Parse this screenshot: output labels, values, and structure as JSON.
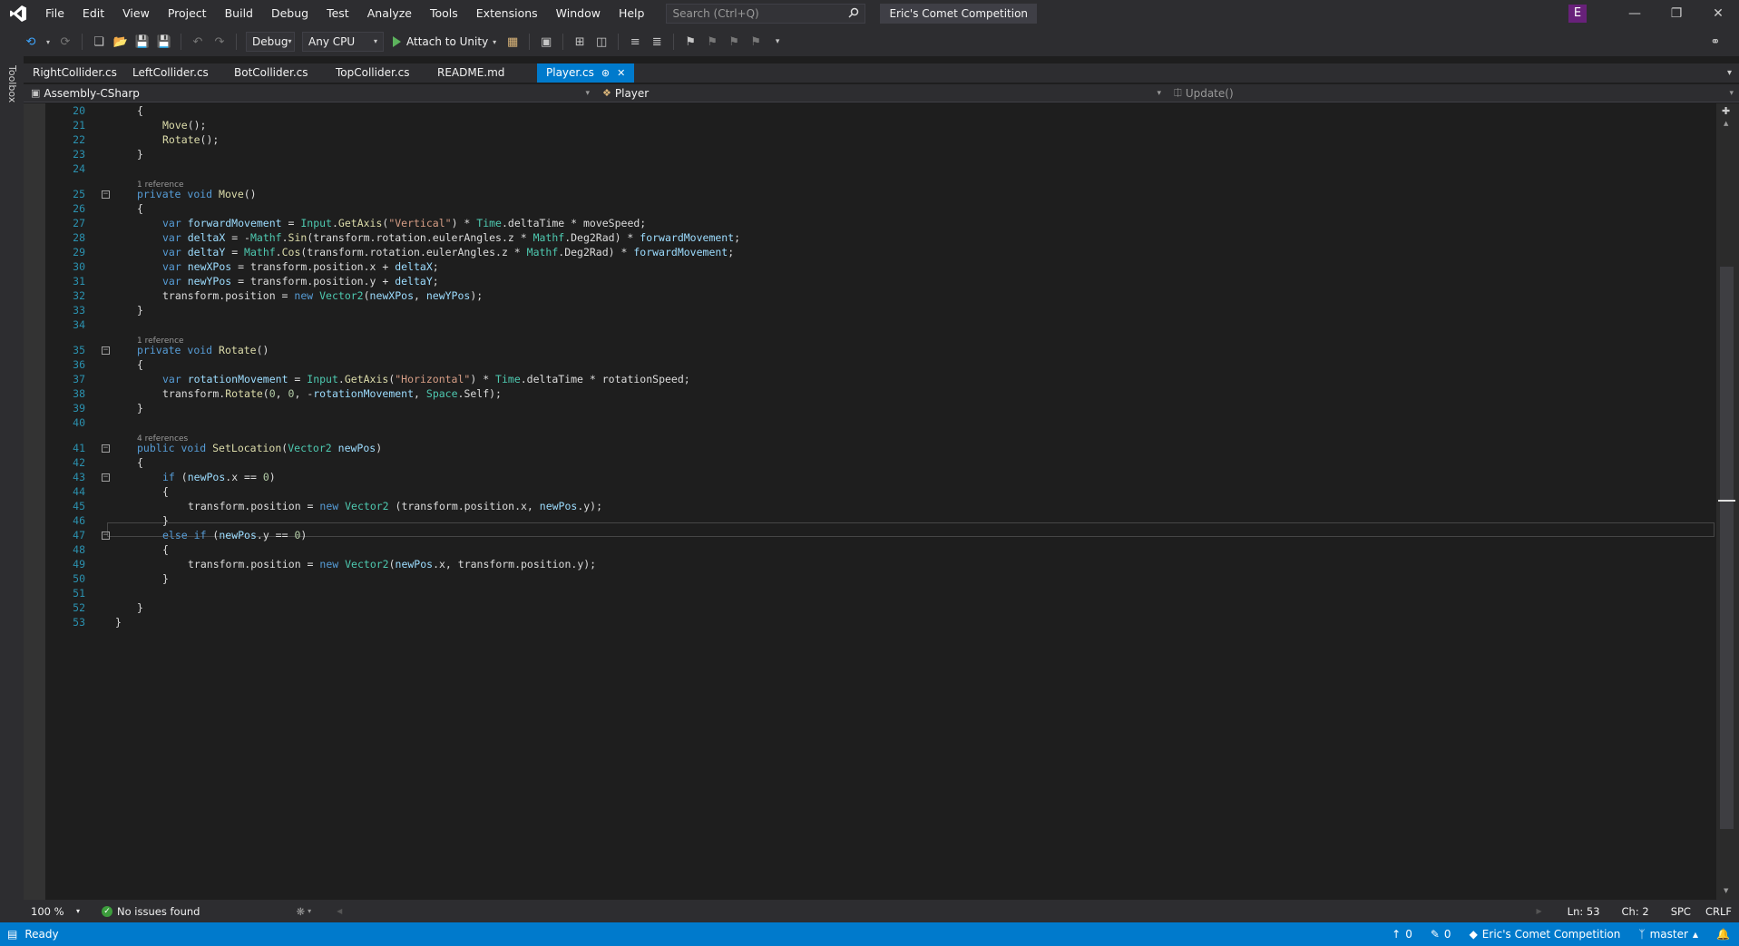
{
  "menu": {
    "items": [
      "File",
      "Edit",
      "View",
      "Project",
      "Build",
      "Debug",
      "Test",
      "Analyze",
      "Tools",
      "Extensions",
      "Window",
      "Help"
    ],
    "search_placeholder": "Search (Ctrl+Q)",
    "solution_name": "Eric's Comet Competition",
    "avatar_letter": "E"
  },
  "toolbar": {
    "config": "Debug",
    "platform": "Any CPU",
    "attach_label": "Attach to Unity"
  },
  "toolbox_label": "Toolbox",
  "tabs": [
    {
      "label": "RightCollider.cs",
      "active": false
    },
    {
      "label": "LeftCollider.cs",
      "active": false
    },
    {
      "label": "BotCollider.cs",
      "active": false
    },
    {
      "label": "TopCollider.cs",
      "active": false
    },
    {
      "label": "README.md",
      "active": false
    },
    {
      "label": "Player.cs",
      "active": true
    }
  ],
  "nav": {
    "project": "Assembly-CSharp",
    "type": "Player",
    "member": "Update()"
  },
  "code": [
    {
      "n": "20",
      "indent": 1,
      "html": "{"
    },
    {
      "n": "21",
      "indent": 2,
      "html": "<span class='fn'>Move</span>();"
    },
    {
      "n": "22",
      "indent": 2,
      "html": "<span class='fn'>Rotate</span>();"
    },
    {
      "n": "23",
      "indent": 1,
      "html": "}"
    },
    {
      "n": "24",
      "indent": 0,
      "html": ""
    },
    {
      "n": "",
      "ref": "1 reference"
    },
    {
      "n": "25",
      "indent": 1,
      "fold": true,
      "html": "<span class='kw'>private</span> <span class='kw'>void</span> <span class='fn'>Move</span>()"
    },
    {
      "n": "26",
      "indent": 1,
      "html": "{"
    },
    {
      "n": "27",
      "indent": 2,
      "html": "<span class='kw'>var</span> <span class='var'>forwardMovement</span> = <span class='ty'>Input</span>.<span class='fn'>GetAxis</span>(<span class='str'>\"Vertical\"</span>) * <span class='ty'>Time</span>.deltaTime * moveSpeed;"
    },
    {
      "n": "28",
      "indent": 2,
      "html": "<span class='kw'>var</span> <span class='var'>deltaX</span> = -<span class='ty'>Mathf</span>.<span class='fn'>Sin</span>(transform.rotation.eulerAngles.z * <span class='ty'>Mathf</span>.Deg2Rad) * <span class='var'>forwardMovement</span>;"
    },
    {
      "n": "29",
      "indent": 2,
      "html": "<span class='kw'>var</span> <span class='var'>deltaY</span> = <span class='ty'>Mathf</span>.<span class='fn'>Cos</span>(transform.rotation.eulerAngles.z * <span class='ty'>Mathf</span>.Deg2Rad) * <span class='var'>forwardMovement</span>;"
    },
    {
      "n": "30",
      "indent": 2,
      "html": "<span class='kw'>var</span> <span class='var'>newXPos</span> = transform.position.x + <span class='var'>deltaX</span>;"
    },
    {
      "n": "31",
      "indent": 2,
      "html": "<span class='kw'>var</span> <span class='var'>newYPos</span> = transform.position.y + <span class='var'>deltaY</span>;"
    },
    {
      "n": "32",
      "indent": 2,
      "html": "transform.position = <span class='kw'>new</span> <span class='ty'>Vector2</span>(<span class='var'>newXPos</span>, <span class='var'>newYPos</span>);"
    },
    {
      "n": "33",
      "indent": 1,
      "html": "}"
    },
    {
      "n": "34",
      "indent": 0,
      "html": ""
    },
    {
      "n": "",
      "ref": "1 reference"
    },
    {
      "n": "35",
      "indent": 1,
      "fold": true,
      "html": "<span class='kw'>private</span> <span class='kw'>void</span> <span class='fn'>Rotate</span>()"
    },
    {
      "n": "36",
      "indent": 1,
      "html": "{"
    },
    {
      "n": "37",
      "indent": 2,
      "html": "<span class='kw'>var</span> <span class='var'>rotationMovement</span> = <span class='ty'>Input</span>.<span class='fn'>GetAxis</span>(<span class='str'>\"Horizontal\"</span>) * <span class='ty'>Time</span>.deltaTime * rotationSpeed;"
    },
    {
      "n": "38",
      "indent": 2,
      "html": "transform.<span class='fn'>Rotate</span>(<span class='num'>0</span>, <span class='num'>0</span>, -<span class='var'>rotationMovement</span>, <span class='ty'>Space</span>.Self);"
    },
    {
      "n": "39",
      "indent": 1,
      "html": "}"
    },
    {
      "n": "40",
      "indent": 0,
      "html": ""
    },
    {
      "n": "",
      "ref": "4 references"
    },
    {
      "n": "41",
      "indent": 1,
      "fold": true,
      "html": "<span class='kw'>public</span> <span class='kw'>void</span> <span class='fn'>SetLocation</span>(<span class='ty'>Vector2</span> <span class='var'>newPos</span>)"
    },
    {
      "n": "42",
      "indent": 1,
      "html": "{"
    },
    {
      "n": "43",
      "indent": 2,
      "fold": true,
      "html": "<span class='kw'>if</span> (<span class='var'>newPos</span>.x == <span class='num'>0</span>)"
    },
    {
      "n": "44",
      "indent": 2,
      "html": "{"
    },
    {
      "n": "45",
      "indent": 3,
      "html": "transform.position = <span class='kw'>new</span> <span class='ty'>Vector2</span> (transform.position.x, <span class='var'>newPos</span>.y);"
    },
    {
      "n": "46",
      "indent": 2,
      "html": "}"
    },
    {
      "n": "47",
      "indent": 2,
      "fold": true,
      "html": "<span class='kw'>else</span> <span class='kw'>if</span> (<span class='var'>newPos</span>.y == <span class='num'>0</span>)"
    },
    {
      "n": "48",
      "indent": 2,
      "html": "{"
    },
    {
      "n": "49",
      "indent": 3,
      "html": "transform.position = <span class='kw'>new</span> <span class='ty'>Vector2</span>(<span class='var'>newPos</span>.x, transform.position.y);"
    },
    {
      "n": "50",
      "indent": 2,
      "html": "}"
    },
    {
      "n": "51",
      "indent": 0,
      "html": ""
    },
    {
      "n": "52",
      "indent": 1,
      "html": "}"
    },
    {
      "n": "53",
      "indent": 0,
      "html": "}"
    }
  ],
  "editor_status": {
    "zoom": "100 %",
    "issues": "No issues found",
    "line": "Ln: 53",
    "col": "Ch: 2",
    "whitespace": "SPC",
    "line_ending": "CRLF"
  },
  "statusbar": {
    "state": "Ready",
    "up_count": "0",
    "pending_count": "0",
    "repo": "Eric's Comet Competition",
    "branch": "master"
  },
  "colors": {
    "accent": "#007acc",
    "chrome": "#2d2d30",
    "editor_bg": "#1e1e1e"
  }
}
